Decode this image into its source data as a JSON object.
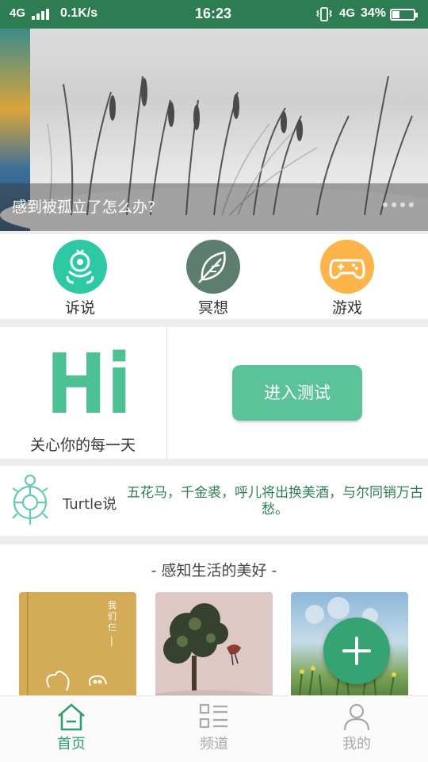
{
  "status_bar": {
    "network": "4G",
    "speed": "0.1K/s",
    "time": "16:23",
    "network2": "4G",
    "battery": "34%",
    "battery_level": 0.34
  },
  "banner": {
    "caption": "感到被孤立了怎么办?"
  },
  "categories": [
    {
      "label": "诉说",
      "color": "#2dc9a5",
      "icon": "robot-icon"
    },
    {
      "label": "冥想",
      "color": "#5d7d6e",
      "icon": "leaf-icon"
    },
    {
      "label": "游戏",
      "color": "#fdb44b",
      "icon": "gamepad-icon"
    }
  ],
  "hi": {
    "graphic_text": "Hi",
    "caption": "关心你的每一天",
    "button": "进入测试"
  },
  "turtle": {
    "title": "Turtle说",
    "quote": "五花马，千金裘，呼儿将出换美酒，与尔同销万古愁。"
  },
  "life": {
    "title": "-  感知生活的美好  -",
    "card1_text": "我们仨"
  },
  "tabs": [
    {
      "label": "首页",
      "icon": "home-icon",
      "active": true
    },
    {
      "label": "频道",
      "icon": "grid-list-icon",
      "active": false
    },
    {
      "label": "我的",
      "icon": "person-icon",
      "active": false
    }
  ],
  "colors": {
    "primary": "#2e7d52",
    "accent": "#35a374",
    "button": "#5cc29a",
    "hi_green": "#4cc194"
  }
}
